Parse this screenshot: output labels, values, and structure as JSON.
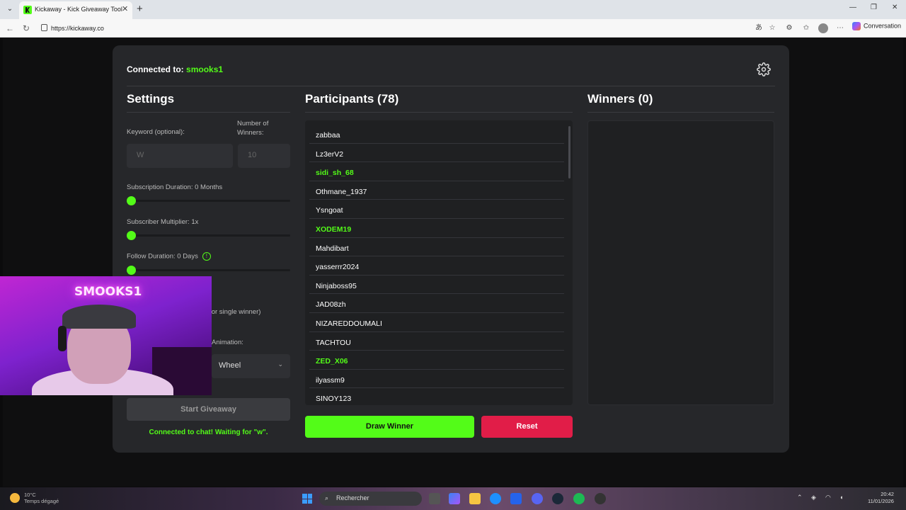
{
  "browser": {
    "tab_title": "Kickaway - Kick Giveaway Tool",
    "url": "https://kickaway.co",
    "conversation_label": "Conversation"
  },
  "header": {
    "connected_label": "Connected to:",
    "username": "smooks1"
  },
  "settings": {
    "title": "Settings",
    "keyword_label": "Keyword (optional):",
    "keyword_placeholder": "W",
    "winners_label": "Number of Winners:",
    "winners_placeholder": "10",
    "sub_duration_label": "Subscription Duration: 0 Months",
    "sub_duration_value": 0,
    "sub_multiplier_label": "Subscriber Multiplier: 1x",
    "sub_multiplier_value": 1,
    "follow_duration_label": "Follow Duration: 0 Days",
    "follow_duration_value": 0,
    "single_winner_label": "n (for single winner)",
    "animation_label": "Animation:",
    "animation_value": "Wheel",
    "start_button": "Start Giveaway",
    "status": "Connected to chat! Waiting for \"w\"."
  },
  "participants": {
    "title": "Participants (78)",
    "items": [
      {
        "name": "zabbaa",
        "subscriber": false
      },
      {
        "name": "Lz3erV2",
        "subscriber": false
      },
      {
        "name": "sidi_sh_68",
        "subscriber": true
      },
      {
        "name": "Othmane_1937",
        "subscriber": false
      },
      {
        "name": "Ysngoat",
        "subscriber": false
      },
      {
        "name": "XODEM19",
        "subscriber": true
      },
      {
        "name": "Mahdibart",
        "subscriber": false
      },
      {
        "name": "yasserrr2024",
        "subscriber": false
      },
      {
        "name": "Ninjaboss95",
        "subscriber": false
      },
      {
        "name": "JAD08zh",
        "subscriber": false
      },
      {
        "name": "NIZAREDDOUMALI",
        "subscriber": false
      },
      {
        "name": "TACHTOU",
        "subscriber": false
      },
      {
        "name": "ZED_X06",
        "subscriber": true
      },
      {
        "name": "ilyassm9",
        "subscriber": false
      },
      {
        "name": "SINOY123",
        "subscriber": false
      }
    ],
    "draw_button": "Draw Winner",
    "reset_button": "Reset"
  },
  "winners": {
    "title": "Winners (0)"
  },
  "webcam": {
    "neon_sign": "SMOOKS1"
  },
  "taskbar": {
    "weather_line1": "10°C",
    "weather_line2": "Temps dégagé",
    "search_placeholder": "Rechercher",
    "time": "20:42",
    "date": "11/01/2026"
  },
  "colors": {
    "accent": "#53fc18",
    "danger": "#e11d48",
    "card": "#26272a"
  }
}
